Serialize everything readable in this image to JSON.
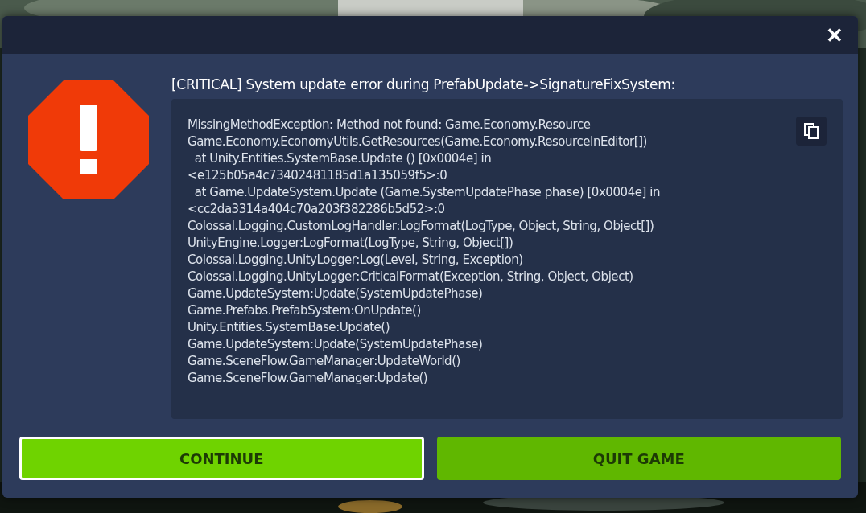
{
  "dialog": {
    "close_label": "✕",
    "title": "[CRITICAL] System update error during PrefabUpdate->SignatureFixSystem:",
    "log_lines": [
      "MissingMethodException: Method not found: Game.Economy.Resource",
      "Game.Economy.EconomyUtils.GetResources(Game.Economy.ResourceInEditor[])",
      "  at Unity.Entities.SystemBase.Update () [0x0004e] in",
      "<e125b05a4c73402481185d1a135059f5>:0",
      "  at Game.UpdateSystem.Update (Game.SystemUpdatePhase phase) [0x0004e] in",
      "<cc2da3314a404c70a203f382286b5d52>:0",
      "Colossal.Logging.CustomLogHandler:LogFormat(LogType, Object, String, Object[])",
      "UnityEngine.Logger:LogFormat(LogType, String, Object[])",
      "Colossal.Logging.UnityLogger:Log(Level, String, Exception)",
      "Colossal.Logging.UnityLogger:CriticalFormat(Exception, String, Object, Object)",
      "Game.UpdateSystem:Update(SystemUpdatePhase)",
      "Game.Prefabs.PrefabSystem:OnUpdate()",
      "Unity.Entities.SystemBase:Update()",
      "Game.UpdateSystem:Update(SystemUpdatePhase)",
      "Game.SceneFlow.GameManager:UpdateWorld()",
      "Game.SceneFlow.GameManager:Update()"
    ],
    "buttons": [
      {
        "label": "CONTINUE",
        "selected": true
      },
      {
        "label": "QUIT GAME",
        "selected": false
      }
    ]
  }
}
